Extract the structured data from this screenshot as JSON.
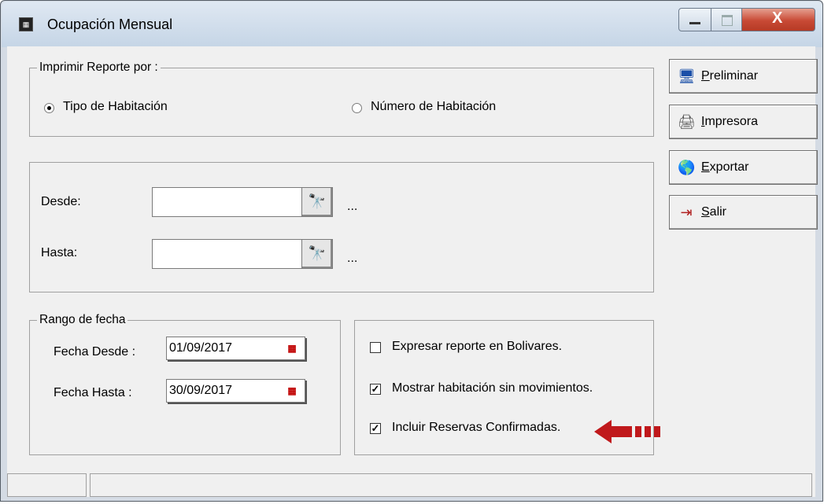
{
  "window": {
    "title": "Ocupación Mensual",
    "app_icon": "app-icon"
  },
  "report_by": {
    "legend": "Imprimir Reporte por :",
    "options": [
      {
        "label": "Tipo de Habitación",
        "selected": true
      },
      {
        "label": "Número de Habitación",
        "selected": false
      }
    ]
  },
  "range": {
    "desde_label": "Desde:",
    "desde_value": "",
    "hasta_label": "Hasta:",
    "hasta_value": "",
    "ellipsis": "..."
  },
  "date_range": {
    "legend": "Rango de fecha",
    "from_label": "Fecha Desde :",
    "from_value": "01/09/2017",
    "to_label": "Fecha Hasta :",
    "to_value": "30/09/2017"
  },
  "options": {
    "bolivares": {
      "label": "Expresar reporte en Bolivares.",
      "checked": false
    },
    "sin_mov": {
      "label": "Mostrar habitación sin movimientos.",
      "checked": true
    },
    "reservas": {
      "label": "Incluir Reservas Confirmadas.",
      "checked": true
    }
  },
  "buttons": {
    "preliminar": {
      "first": "P",
      "rest": "reliminar",
      "icon": "monitor-icon"
    },
    "impresora": {
      "first": "I",
      "rest": "mpresora",
      "icon": "printer-icon"
    },
    "exportar": {
      "first": "E",
      "rest": "xportar",
      "icon": "globe-icon"
    },
    "salir": {
      "first": "S",
      "rest": "alir",
      "icon": "exit-door-icon"
    }
  },
  "colors": {
    "arrow": "#c0191c",
    "close": "#c84a35"
  }
}
